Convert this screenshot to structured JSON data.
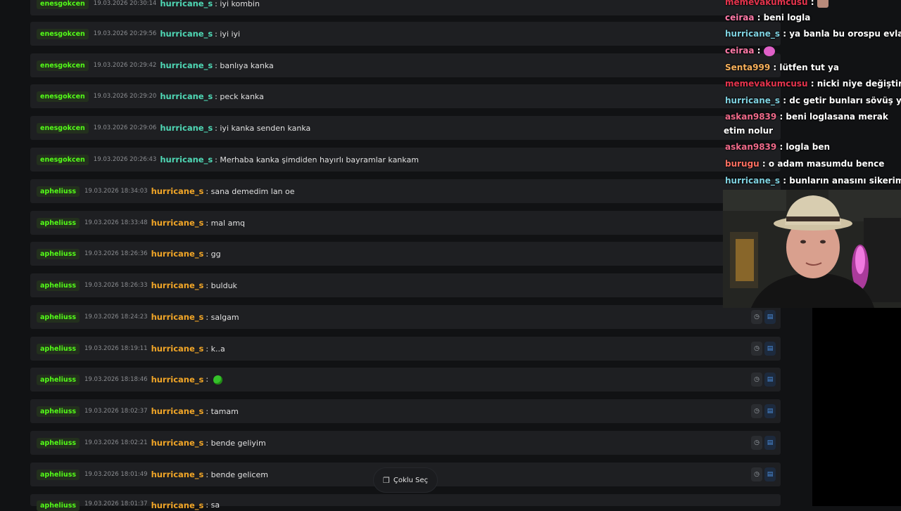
{
  "rows": [
    {
      "mod": "enesgokcen",
      "ts": "19.03.2026 20:30:14",
      "user": "hurricane_s",
      "color": "teal",
      "msg": "iyi kombin"
    },
    {
      "mod": "enesgokcen",
      "ts": "19.03.2026 20:29:56",
      "user": "hurricane_s",
      "color": "teal",
      "msg": "iyi iyi"
    },
    {
      "mod": "enesgokcen",
      "ts": "19.03.2026 20:29:42",
      "user": "hurricane_s",
      "color": "teal",
      "msg": "banlıya kanka"
    },
    {
      "mod": "enesgokcen",
      "ts": "19.03.2026 20:29:20",
      "user": "hurricane_s",
      "color": "teal",
      "msg": "peck kanka"
    },
    {
      "mod": "enesgokcen",
      "ts": "19.03.2026 20:29:06",
      "user": "hurricane_s",
      "color": "teal",
      "msg": "iyi kanka senden kanka"
    },
    {
      "mod": "enesgokcen",
      "ts": "19.03.2026 20:26:43",
      "user": "hurricane_s",
      "color": "teal",
      "msg": "Merhaba kanka şimdiden hayırlı bayramlar kankam"
    },
    {
      "mod": "apheliuss",
      "ts": "19.03.2026 18:34:03",
      "user": "hurricane_s",
      "color": "orange",
      "msg": "sana demedim lan oe"
    },
    {
      "mod": "apheliuss",
      "ts": "19.03.2026 18:33:48",
      "user": "hurricane_s",
      "color": "orange",
      "msg": "mal amq"
    },
    {
      "mod": "apheliuss",
      "ts": "19.03.2026 18:26:36",
      "user": "hurricane_s",
      "color": "orange",
      "msg": "gg"
    },
    {
      "mod": "apheliuss",
      "ts": "19.03.2026 18:26:33",
      "user": "hurricane_s",
      "color": "orange",
      "msg": "bulduk"
    },
    {
      "mod": "apheliuss",
      "ts": "19.03.2026 18:24:23",
      "user": "hurricane_s",
      "color": "orange",
      "msg": "salgam"
    },
    {
      "mod": "apheliuss",
      "ts": "19.03.2026 18:19:11",
      "user": "hurricane_s",
      "color": "orange",
      "msg": "k..a"
    },
    {
      "mod": "apheliuss",
      "ts": "19.03.2026 18:18:46",
      "user": "hurricane_s",
      "color": "orange",
      "msg": ""
    },
    {
      "mod": "apheliuss",
      "ts": "19.03.2026 18:02:37",
      "user": "hurricane_s",
      "color": "orange",
      "msg": "tamam"
    },
    {
      "mod": "apheliuss",
      "ts": "19.03.2026 18:02:21",
      "user": "hurricane_s",
      "color": "orange",
      "msg": "bende geliyim"
    },
    {
      "mod": "apheliuss",
      "ts": "19.03.2026 18:01:49",
      "user": "hurricane_s",
      "color": "orange",
      "msg": "bende gelicem"
    },
    {
      "mod": "apheliuss",
      "ts": "19.03.2026 18:01:37",
      "user": "hurricane_s",
      "color": "orange",
      "msg": "sa"
    }
  ],
  "multi_select_label": "Çoklu Seç",
  "overlay_chat": [
    {
      "user": "memevakumcusu",
      "color": "#e4344d",
      "text": ""
    },
    {
      "user": "ceiraa",
      "color": "#ff7aa8",
      "text": "beni logla"
    },
    {
      "user": "hurricane_s",
      "color": "#7fd1e0",
      "text": "ya banla bu orospu evlatlarını"
    },
    {
      "user": "ceiraa",
      "color": "#ff7aa8",
      "text": ""
    },
    {
      "user": "Senta999",
      "color": "#f7b05b",
      "text": "lütfen tut ya"
    },
    {
      "user": "memevakumcusu",
      "color": "#e4344d",
      "text": "nicki niye değiştirdin"
    },
    {
      "user": "hurricane_s",
      "color": "#7fd1e0",
      "text": "dc getir bunları sövüş yapıyım"
    },
    {
      "user": "askan9839",
      "color": "#f06a8a",
      "text": "beni loglasana merak etim nolur"
    },
    {
      "user": "askan9839",
      "color": "#f06a8a",
      "text": "logla ben"
    },
    {
      "user": "burugu",
      "color": "#ff6f61",
      "text": "o adam masumdu bence"
    },
    {
      "user": "hurricane_s",
      "color": "#7fd1e0",
      "text": "bunların anasını sikerim"
    }
  ],
  "colors": {
    "teal": "#4fd8b5",
    "orange": "#f2a627",
    "mod_green": "#53fc18",
    "row_bg": "#1e1f22",
    "page_bg": "#111214"
  },
  "icons": {
    "row_action_1": "history-icon",
    "row_action_2": "save-icon",
    "multi_select": "copy-icon"
  }
}
